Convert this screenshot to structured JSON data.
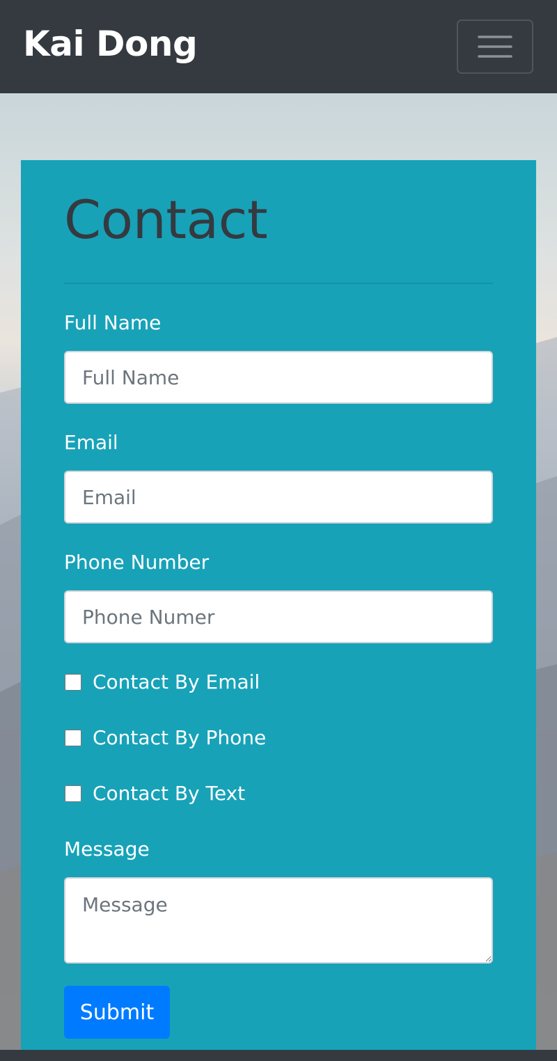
{
  "navbar": {
    "brand": "Kai Dong",
    "toggler_icon": "hamburger-menu-icon"
  },
  "contact": {
    "title": "Contact",
    "full_name": {
      "label": "Full Name",
      "placeholder": "Full Name",
      "value": ""
    },
    "email": {
      "label": "Email",
      "placeholder": "Email",
      "value": ""
    },
    "phone": {
      "label": "Phone Number",
      "placeholder": "Phone Numer",
      "value": ""
    },
    "checkboxes": [
      {
        "label": "Contact By Email",
        "checked": false
      },
      {
        "label": "Contact By Phone",
        "checked": false
      },
      {
        "label": "Contact By Text",
        "checked": false
      }
    ],
    "message": {
      "label": "Message",
      "placeholder": "Message",
      "value": ""
    },
    "submit_label": "Submit"
  },
  "colors": {
    "navbar_bg": "#343a40",
    "card_bg": "#17a2b8",
    "title_color": "#343a40",
    "submit_bg": "#007bff"
  }
}
